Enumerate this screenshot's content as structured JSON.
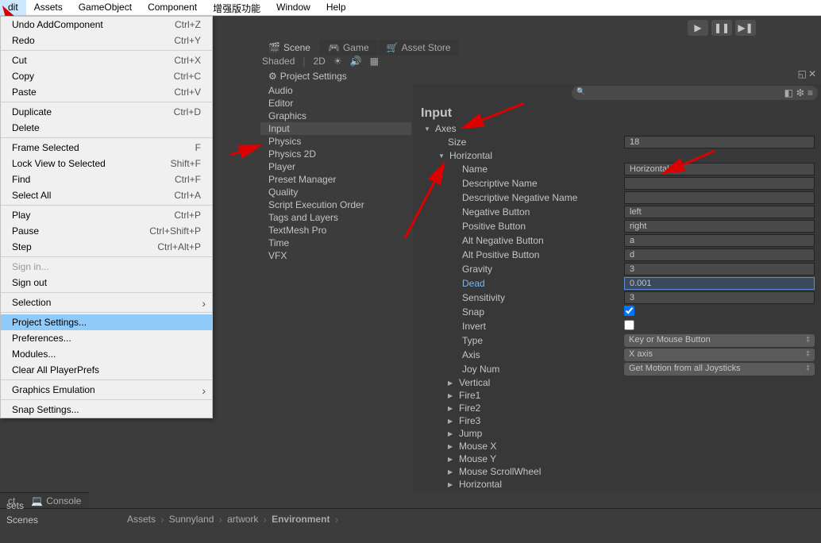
{
  "menubar": [
    "dit",
    "Assets",
    "GameObject",
    "Component",
    "增强版功能",
    "Window",
    "Help"
  ],
  "dropdown": {
    "groups": [
      [
        {
          "label": "Undo AddComponent",
          "shortcut": "Ctrl+Z"
        },
        {
          "label": "Redo",
          "shortcut": "Ctrl+Y"
        }
      ],
      [
        {
          "label": "Cut",
          "shortcut": "Ctrl+X"
        },
        {
          "label": "Copy",
          "shortcut": "Ctrl+C"
        },
        {
          "label": "Paste",
          "shortcut": "Ctrl+V"
        }
      ],
      [
        {
          "label": "Duplicate",
          "shortcut": "Ctrl+D"
        },
        {
          "label": "Delete",
          "shortcut": ""
        }
      ],
      [
        {
          "label": "Frame Selected",
          "shortcut": "F"
        },
        {
          "label": "Lock View to Selected",
          "shortcut": "Shift+F"
        },
        {
          "label": "Find",
          "shortcut": "Ctrl+F"
        },
        {
          "label": "Select All",
          "shortcut": "Ctrl+A"
        }
      ],
      [
        {
          "label": "Play",
          "shortcut": "Ctrl+P"
        },
        {
          "label": "Pause",
          "shortcut": "Ctrl+Shift+P"
        },
        {
          "label": "Step",
          "shortcut": "Ctrl+Alt+P"
        }
      ],
      [
        {
          "label": "Sign in...",
          "shortcut": "",
          "disabled": true
        },
        {
          "label": "Sign out",
          "shortcut": ""
        }
      ],
      [
        {
          "label": "Selection",
          "shortcut": "",
          "arrow": true
        }
      ],
      [
        {
          "label": "Project Settings...",
          "shortcut": "",
          "highlighted": true
        },
        {
          "label": "Preferences...",
          "shortcut": ""
        },
        {
          "label": "Modules...",
          "shortcut": ""
        },
        {
          "label": "Clear All PlayerPrefs",
          "shortcut": ""
        }
      ],
      [
        {
          "label": "Graphics Emulation",
          "shortcut": "",
          "arrow": true
        }
      ],
      [
        {
          "label": "Snap Settings...",
          "shortcut": ""
        }
      ]
    ]
  },
  "scene_tabs": [
    {
      "icon": "🎬",
      "label": "Scene",
      "active": true
    },
    {
      "icon": "🎮",
      "label": "Game"
    },
    {
      "icon": "🛒",
      "label": "Asset Store"
    }
  ],
  "scene_sub": {
    "shaded": "Shaded",
    "twod": "2D"
  },
  "ps_tab": {
    "icon": "⚙",
    "label": "Project Settings"
  },
  "categories": [
    "Audio",
    "Editor",
    "Graphics",
    "Input",
    "Physics",
    "Physics 2D",
    "Player",
    "Preset Manager",
    "Quality",
    "Script Execution Order",
    "Tags and Layers",
    "TextMesh Pro",
    "Time",
    "VFX"
  ],
  "categories_selected": "Input",
  "panel": {
    "title": "Input",
    "axes_label": "Axes",
    "size_label": "Size",
    "size_value": "18",
    "horizontal_label": "Horizontal",
    "props": [
      {
        "label": "Name",
        "value": "Horizontal",
        "type": "text"
      },
      {
        "label": "Descriptive Name",
        "value": "",
        "type": "text"
      },
      {
        "label": "Descriptive Negative Name",
        "value": "",
        "type": "text"
      },
      {
        "label": "Negative Button",
        "value": "left",
        "type": "text"
      },
      {
        "label": "Positive Button",
        "value": "right",
        "type": "text"
      },
      {
        "label": "Alt Negative Button",
        "value": "a",
        "type": "text"
      },
      {
        "label": "Alt Positive Button",
        "value": "d",
        "type": "text"
      },
      {
        "label": "Gravity",
        "value": "3",
        "type": "text"
      },
      {
        "label": "Dead",
        "value": "0.001",
        "type": "text",
        "active": true
      },
      {
        "label": "Sensitivity",
        "value": "3",
        "type": "text"
      },
      {
        "label": "Snap",
        "value": true,
        "type": "check"
      },
      {
        "label": "Invert",
        "value": false,
        "type": "check"
      },
      {
        "label": "Type",
        "value": "Key or Mouse Button",
        "type": "dropdown"
      },
      {
        "label": "Axis",
        "value": "X axis",
        "type": "dropdown"
      },
      {
        "label": "Joy Num",
        "value": "Get Motion from all Joysticks",
        "type": "dropdown"
      }
    ],
    "collapsed": [
      "Vertical",
      "Fire1",
      "Fire2",
      "Fire3",
      "Jump",
      "Mouse X",
      "Mouse Y",
      "Mouse ScrollWheel",
      "Horizontal"
    ]
  },
  "bottom_tabs": [
    {
      "icon": "📁",
      "label": "ct"
    },
    {
      "icon": "💻",
      "label": "Console"
    }
  ],
  "breadcrumb": [
    "Assets",
    "Sunnyland",
    "artwork",
    "Environment"
  ],
  "bottom_left": [
    "sets",
    "Scenes"
  ]
}
